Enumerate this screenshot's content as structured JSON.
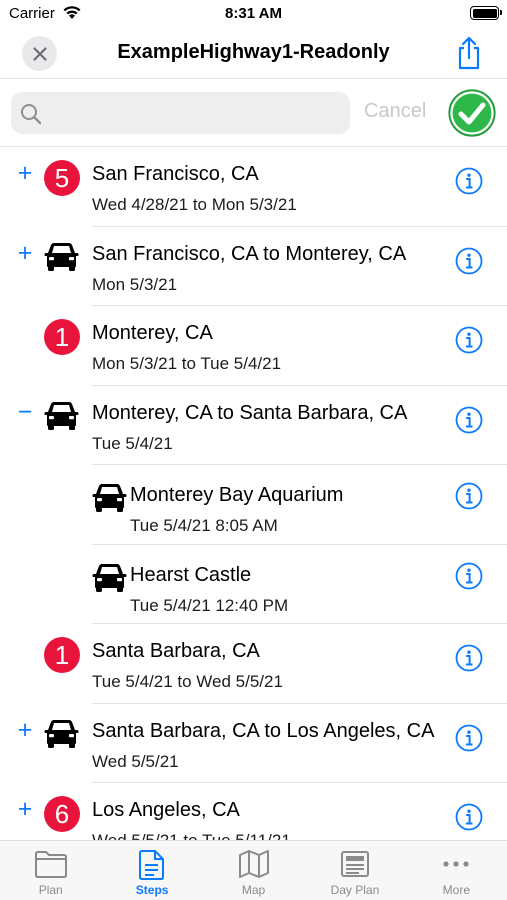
{
  "status_bar": {
    "carrier": "Carrier",
    "time": "8:31 AM"
  },
  "nav": {
    "title": "ExampleHighway1-Readonly"
  },
  "search": {
    "placeholder": "",
    "value": "",
    "cancel_label": "Cancel"
  },
  "icons": {
    "close": "close-icon",
    "share": "share-icon",
    "search": "search-icon",
    "done": "checkmark-circle-icon",
    "car": "car-icon",
    "info": "info-icon"
  },
  "colors": {
    "accent": "#0a7aff",
    "badge": "#e8143c",
    "done_green": "#2fb84a"
  },
  "steps": [
    {
      "expander": "+",
      "badge": "5",
      "title": "San Francisco, CA",
      "subtitle": "Wed 4/28/21 to Mon 5/3/21"
    },
    {
      "expander": "+",
      "icon": "car-icon",
      "title": "San Francisco, CA to Monterey, CA",
      "subtitle": "Mon 5/3/21"
    },
    {
      "expander": "",
      "badge": "1",
      "title": "Monterey, CA",
      "subtitle": "Mon 5/3/21 to Tue 5/4/21"
    },
    {
      "expander": "−",
      "icon": "car-icon",
      "title": "Monterey, CA to Santa Barbara, CA",
      "subtitle": "Tue 5/4/21"
    },
    {
      "expander": "",
      "icon": "car-icon",
      "child": true,
      "title": "Monterey Bay Aquarium",
      "subtitle": "Tue 5/4/21 8:05 AM"
    },
    {
      "expander": "",
      "icon": "car-icon",
      "child": true,
      "title": "Hearst Castle",
      "subtitle": "Tue 5/4/21 12:40 PM"
    },
    {
      "expander": "",
      "badge": "1",
      "title": "Santa Barbara, CA",
      "subtitle": "Tue 5/4/21 to Wed 5/5/21"
    },
    {
      "expander": "+",
      "icon": "car-icon",
      "title": "Santa Barbara, CA to Los Angeles, CA",
      "subtitle": "Wed 5/5/21"
    },
    {
      "expander": "+",
      "badge": "6",
      "title": "Los Angeles, CA",
      "subtitle": "Wed 5/5/21 to Tue 5/11/21"
    }
  ],
  "tabs": [
    {
      "label": "Plan",
      "icon": "folder-icon",
      "active": false
    },
    {
      "label": "Steps",
      "icon": "document-icon",
      "active": true
    },
    {
      "label": "Map",
      "icon": "map-icon",
      "active": false
    },
    {
      "label": "Day Plan",
      "icon": "newspaper-icon",
      "active": false
    },
    {
      "label": "More",
      "icon": "more-icon",
      "active": false
    }
  ]
}
